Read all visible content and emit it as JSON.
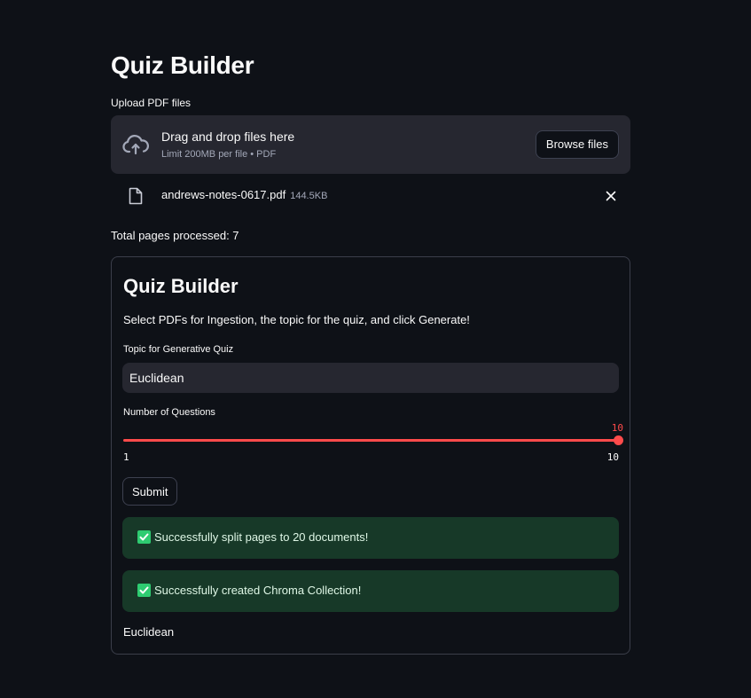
{
  "page": {
    "title": "Quiz Builder"
  },
  "uploader": {
    "label": "Upload PDF files",
    "drag_text": "Drag and drop files here",
    "limit_text": "Limit 200MB per file • PDF",
    "browse_label": "Browse files",
    "icon": "cloud-upload-icon"
  },
  "files": [
    {
      "name": "andrews-notes-0617.pdf",
      "size": "144.5KB",
      "icon": "file-icon",
      "remove_icon": "close-icon"
    }
  ],
  "status": {
    "pages_processed": "Total pages processed: 7"
  },
  "form": {
    "title": "Quiz Builder",
    "description": "Select PDFs for Ingestion, the topic for the quiz, and click Generate!",
    "topic_label": "Topic for Generative Quiz",
    "topic_value": "Euclidean",
    "questions_label": "Number of Questions",
    "slider": {
      "value": "10",
      "min": "1",
      "max": "10"
    },
    "submit_label": "Submit"
  },
  "alerts": [
    {
      "text": "Successfully split pages to 20 documents!",
      "icon": "checkmark-icon"
    },
    {
      "text": "Successfully created Chroma Collection!",
      "icon": "checkmark-icon"
    }
  ],
  "result": {
    "text": "Euclidean"
  },
  "colors": {
    "background": "#0e1117",
    "surface": "#262730",
    "accent": "#ff4b4b",
    "success_bg": "#173928",
    "success_icon": "#2ecc71"
  }
}
